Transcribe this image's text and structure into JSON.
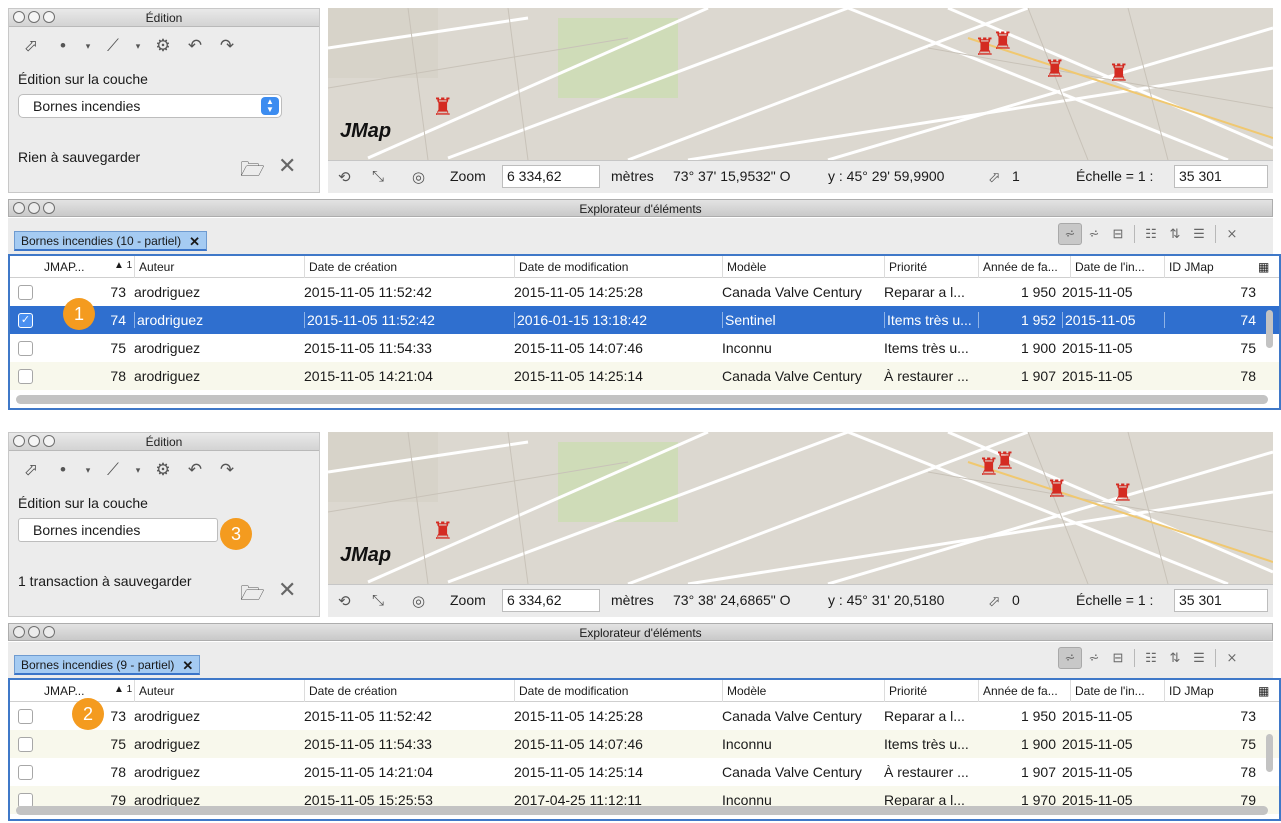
{
  "screens": [
    {
      "edition": {
        "title": "Édition",
        "layer_label": "Édition sur la couche",
        "layer": "Bornes incendies",
        "status": "Rien à sauvegarder"
      },
      "map": {
        "logo": "JMap"
      },
      "statusbar": {
        "zoom_label": "Zoom",
        "zoom": "6 334,62",
        "unit": "mètres",
        "lon": "73° 37' 15,9532\" O",
        "lat": "y : 45° 29' 59,9900",
        "selection": "1",
        "scale_label": "Échelle = 1 :",
        "scale": "35 301"
      },
      "explorer": {
        "title": "Explorateur d'éléments",
        "tab": "Bornes incendies (10 - partiel)",
        "tab_close": "✕"
      },
      "columns": [
        "JMAP...",
        "▲ 1",
        "Auteur",
        "Date de création",
        "Date de modification",
        "Modèle",
        "Priorité",
        "Année de fa...",
        "Date de l'in...",
        "ID JMap",
        "▦"
      ],
      "rows": [
        {
          "id": "73",
          "author": "arodriguez",
          "created": "2015-11-05 11:52:42",
          "modified": "2015-11-05 14:25:28",
          "model": "Canada Valve Century",
          "priority": "Reparar a l...",
          "year": "1 950",
          "install": "2015-11-05",
          "jmap": "73",
          "checked": false,
          "selected": false
        },
        {
          "id": "74",
          "author": "arodriguez",
          "created": "2015-11-05 11:52:42",
          "modified": "2016-01-15 13:18:42",
          "model": "Sentinel",
          "priority": "Items très u...",
          "year": "1 952",
          "install": "2015-11-05",
          "jmap": "74",
          "checked": true,
          "selected": true
        },
        {
          "id": "75",
          "author": "arodriguez",
          "created": "2015-11-05 11:54:33",
          "modified": "2015-11-05 14:07:46",
          "model": "Inconnu",
          "priority": "Items très u...",
          "year": "1 900",
          "install": "2015-11-05",
          "jmap": "75",
          "checked": false,
          "selected": false
        },
        {
          "id": "78",
          "author": "arodriguez",
          "created": "2015-11-05 14:21:04",
          "modified": "2015-11-05 14:25:14",
          "model": "Canada Valve Century",
          "priority": "À restaurer ...",
          "year": "1 907",
          "install": "2015-11-05",
          "jmap": "78",
          "checked": false,
          "selected": false
        }
      ],
      "badges": [
        {
          "label": "1"
        }
      ]
    },
    {
      "edition": {
        "title": "Édition",
        "layer_label": "Édition sur la couche",
        "layer": "Bornes incendies",
        "status": "1 transaction à sauvegarder"
      },
      "map": {
        "logo": "JMap"
      },
      "statusbar": {
        "zoom_label": "Zoom",
        "zoom": "6 334,62",
        "unit": "mètres",
        "lon": "73° 38' 24,6865\" O",
        "lat": "y : 45° 31' 20,5180",
        "selection": "0",
        "scale_label": "Échelle = 1 :",
        "scale": "35 301"
      },
      "explorer": {
        "title": "Explorateur d'éléments",
        "tab": "Bornes incendies (9 - partiel)",
        "tab_close": "✕"
      },
      "columns": [
        "JMAP...",
        "▲ 1",
        "Auteur",
        "Date de création",
        "Date de modification",
        "Modèle",
        "Priorité",
        "Année de fa...",
        "Date de l'in...",
        "ID JMap",
        "▦"
      ],
      "rows": [
        {
          "id": "73",
          "author": "arodriguez",
          "created": "2015-11-05 11:52:42",
          "modified": "2015-11-05 14:25:28",
          "model": "Canada Valve Century",
          "priority": "Reparar a l...",
          "year": "1 950",
          "install": "2015-11-05",
          "jmap": "73",
          "checked": false,
          "selected": false
        },
        {
          "id": "75",
          "author": "arodriguez",
          "created": "2015-11-05 11:54:33",
          "modified": "2015-11-05 14:07:46",
          "model": "Inconnu",
          "priority": "Items très u...",
          "year": "1 900",
          "install": "2015-11-05",
          "jmap": "75",
          "checked": false,
          "selected": false
        },
        {
          "id": "78",
          "author": "arodriguez",
          "created": "2015-11-05 14:21:04",
          "modified": "2015-11-05 14:25:14",
          "model": "Canada Valve Century",
          "priority": "À restaurer ...",
          "year": "1 907",
          "install": "2015-11-05",
          "jmap": "78",
          "checked": false,
          "selected": false
        },
        {
          "id": "79",
          "author": "arodriguez",
          "created": "2015-11-05 15:25:53",
          "modified": "2017-04-25 11:12:11",
          "model": "Inconnu",
          "priority": "Reparar a l...",
          "year": "1 970",
          "install": "2015-11-05",
          "jmap": "79",
          "checked": false,
          "selected": false
        }
      ],
      "badges": [
        {
          "label": "2"
        },
        {
          "label": "3"
        }
      ]
    }
  ],
  "colors": {
    "selection": "#2f6fcf",
    "badge": "#f49b1f",
    "hydrant": "#d42b22",
    "tab": "#a5cbf2"
  },
  "icons": [
    "edit-tool-icon",
    "point-icon",
    "polygon-icon",
    "move-icon",
    "undo-icon",
    "redo-icon",
    "save-icon",
    "cancel-icon",
    "hydrant-icon"
  ]
}
